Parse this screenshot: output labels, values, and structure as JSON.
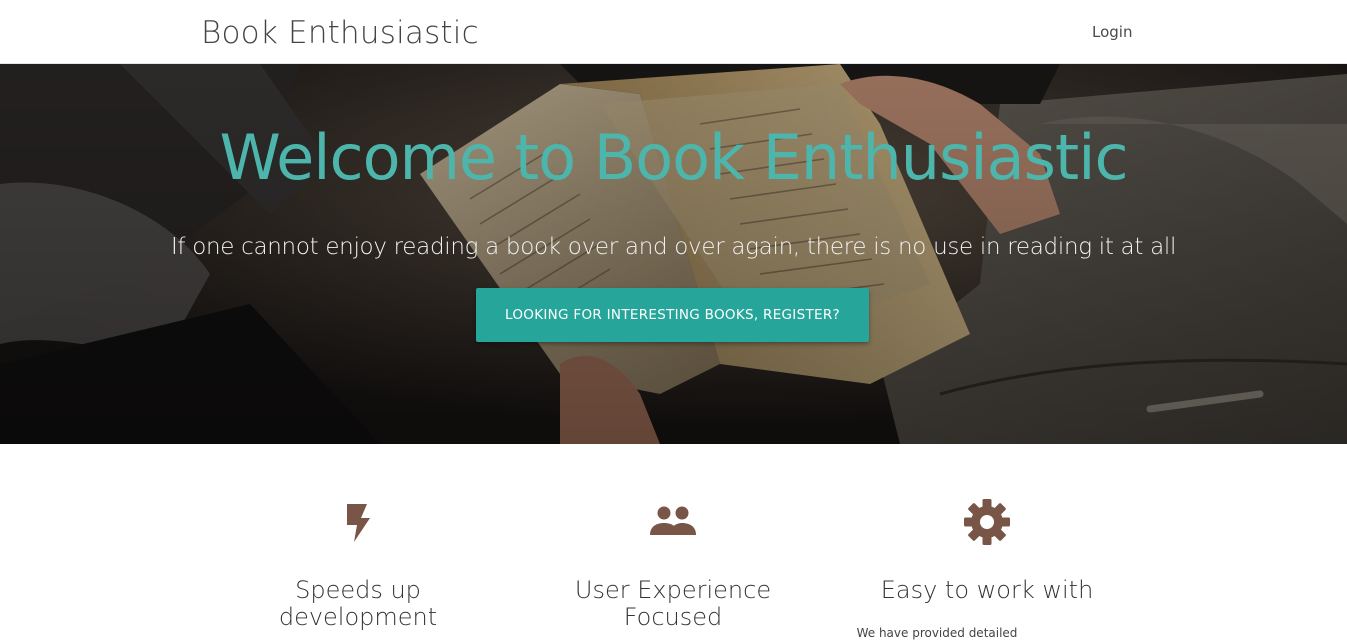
{
  "nav": {
    "brand": "Book Enthusiastic",
    "login_label": "Login"
  },
  "hero": {
    "title": "Welcome to Book Enthusiastic",
    "subtitle": "If one cannot enjoy reading a book over and over again, there is no use in reading it at all",
    "cta_label": "LOOKING FOR INTERESTING BOOKS, REGISTER?",
    "background_image": "person-holding-open-book-photo"
  },
  "features": [
    {
      "icon": "bolt-icon",
      "title_line1": "Speeds up",
      "title_line2": "development",
      "text": ""
    },
    {
      "icon": "people-icon",
      "title_line1": "User Experience",
      "title_line2": "Focused",
      "text": ""
    },
    {
      "icon": "gear-icon",
      "title_line1": "Easy to work with",
      "title_line2": "",
      "text": "We have provided detailed"
    }
  ],
  "colors": {
    "accent_teal": "#26a69a",
    "title_teal": "#4db6ac",
    "icon_brown": "#795548",
    "nav_text": "#444444"
  }
}
